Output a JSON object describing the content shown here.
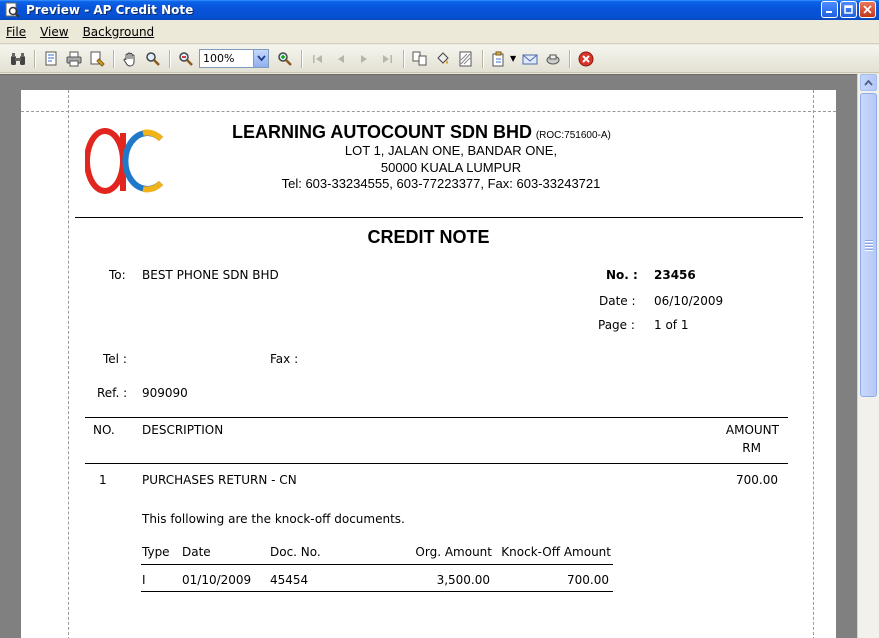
{
  "window": {
    "title": "Preview - AP Credit Note"
  },
  "menu": {
    "file": "File",
    "view": "View",
    "background": "Background"
  },
  "toolbar": {
    "zoom_value": "100%"
  },
  "report": {
    "company_name": "LEARNING AUTOCOUNT SDN BHD",
    "roc": "(ROC:751600-A)",
    "address_line1": "LOT 1, JALAN ONE,  BANDAR ONE,",
    "address_line2": "50000  KUALA LUMPUR",
    "contact_line": "Tel:  603-33234555,  603-77223377,  Fax: 603-33243721",
    "doc_title": "CREDIT NOTE",
    "to_label": "To:",
    "to_value": "BEST PHONE SDN BHD",
    "no_label": "No.  :",
    "no_value": "23456",
    "date_label": "Date   :",
    "date_value": "06/10/2009",
    "page_label": "Page   :",
    "page_value": "1 of 1",
    "tel_label": "Tel :",
    "fax_label": "Fax :",
    "ref_label": "Ref. :",
    "ref_value": "909090",
    "col_no": "NO.",
    "col_description": "DESCRIPTION",
    "col_amount": "AMOUNT",
    "col_amount_unit": "RM",
    "lines": [
      {
        "no": "1",
        "description": "PURCHASES RETURN - CN",
        "amount": "700.00"
      }
    ],
    "knockoff_note": "This following are the knock-off documents.",
    "knockoff_headers": {
      "type": "Type",
      "date": "Date",
      "doc_no": "Doc. No.",
      "org_amount": "Org. Amount",
      "knockoff_amount": "Knock-Off Amount"
    },
    "knockoff_rows": [
      {
        "type": "I",
        "date": "01/10/2009",
        "doc_no": "45454",
        "org_amount": "3,500.00",
        "knockoff_amount": "700.00"
      }
    ]
  },
  "colors": {
    "titlebar": "#0854DA",
    "logo_red": "#E0261E",
    "logo_blue": "#1F78C8",
    "logo_yellow": "#F2B21A",
    "close_icon": "#D8362A"
  }
}
